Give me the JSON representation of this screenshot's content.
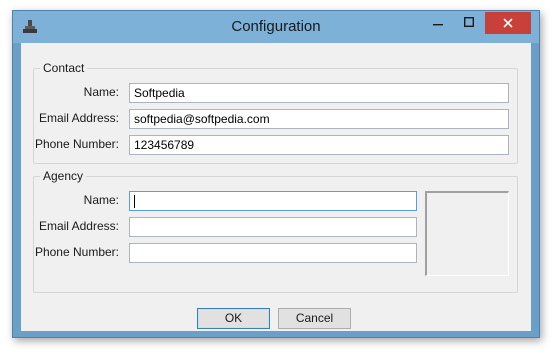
{
  "window": {
    "title": "Configuration"
  },
  "contact": {
    "legend": "Contact",
    "name_label": "Name:",
    "name_value": "Softpedia",
    "email_label": "Email Address:",
    "email_value": "softpedia@softpedia.com",
    "phone_label": "Phone Number:",
    "phone_value": "123456789"
  },
  "agency": {
    "legend": "Agency",
    "name_label": "Name:",
    "name_value": "",
    "email_label": "Email Address:",
    "email_value": "",
    "phone_label": "Phone Number:",
    "phone_value": ""
  },
  "buttons": {
    "ok": "OK",
    "cancel": "Cancel"
  },
  "icons": {
    "app": "stamp-icon",
    "minimize": "minimize-icon",
    "maximize": "maximize-icon",
    "close": "close-icon"
  },
  "colors": {
    "titlebar": "#7db1d8",
    "close": "#c7413a",
    "focus": "#569de5"
  }
}
